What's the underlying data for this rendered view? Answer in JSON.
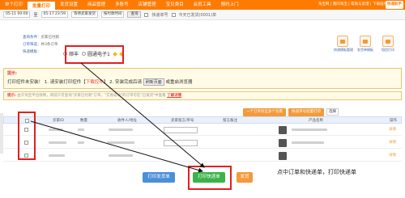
{
  "topnav": {
    "tabs": [
      "单个打印",
      "批量打印",
      "发货设置",
      "商品管理",
      "多账号",
      "店铺管理",
      "宝贝类目",
      "会员工具",
      "预约上门"
    ],
    "active_index": 1,
    "right_links": "淘宝网 | 我的淘宝 | 帮助与反馈 | 下载插件",
    "logo": "快递助手"
  },
  "filterbar": {
    "start_date": "05-11 00:00",
    "end_date": "05-17 23:59",
    "date_sep": "至",
    "status": "等待卖家发货",
    "sort": "按付款时间",
    "search_btn": "查询",
    "options": [
      "快递单号",
      "今天已发货(0001)单"
    ]
  },
  "info": {
    "line1_label": "查询条件：",
    "line1_value": "买家已付款",
    "line2_label": "订单筛选：",
    "line2_value": "共3条订单",
    "line3_label": "快递模板："
  },
  "express": {
    "option_a": "顺丰",
    "option_b": "圆通电子1"
  },
  "icons": [
    "快递模板管理",
    "发货单模板",
    "短信打印"
  ],
  "tip": {
    "title": "提示:",
    "text_a": "打印控件未安装！ 1. 请安装打印控件【",
    "link": "下载控件",
    "text_b": "】 2. 安装完成后请",
    "refresh": "刷新页面",
    "text_c": "或重启浏览器"
  },
  "tip2": {
    "label": "提示:",
    "text": "由于淘宝平台限制，目前只可查询\"买家已付款\"订单，\"交易成功\"的订单可在\"已发货\"中查看",
    "link": "了解详情"
  },
  "tabs2": [
    "一个订单对应多个包裹",
    "快递单号批量打印",
    "选择"
  ],
  "thead": {
    "col_buyer": "买家ID",
    "col_qty": "数量",
    "col_addr": "收件人/地址",
    "col_remark": "卖家留言/单号",
    "col_note": "留言备注",
    "col_product": "产品名称",
    "col_op": "操作"
  },
  "rows": [
    {
      "op": "详情"
    },
    {
      "op": "详情"
    },
    {
      "op": "详情"
    }
  ],
  "buttons": {
    "print_delivery": "打印发货单",
    "print_express": "打印快递单",
    "ship": "发货"
  },
  "caption": "点中订单和快递单，打印快递单"
}
